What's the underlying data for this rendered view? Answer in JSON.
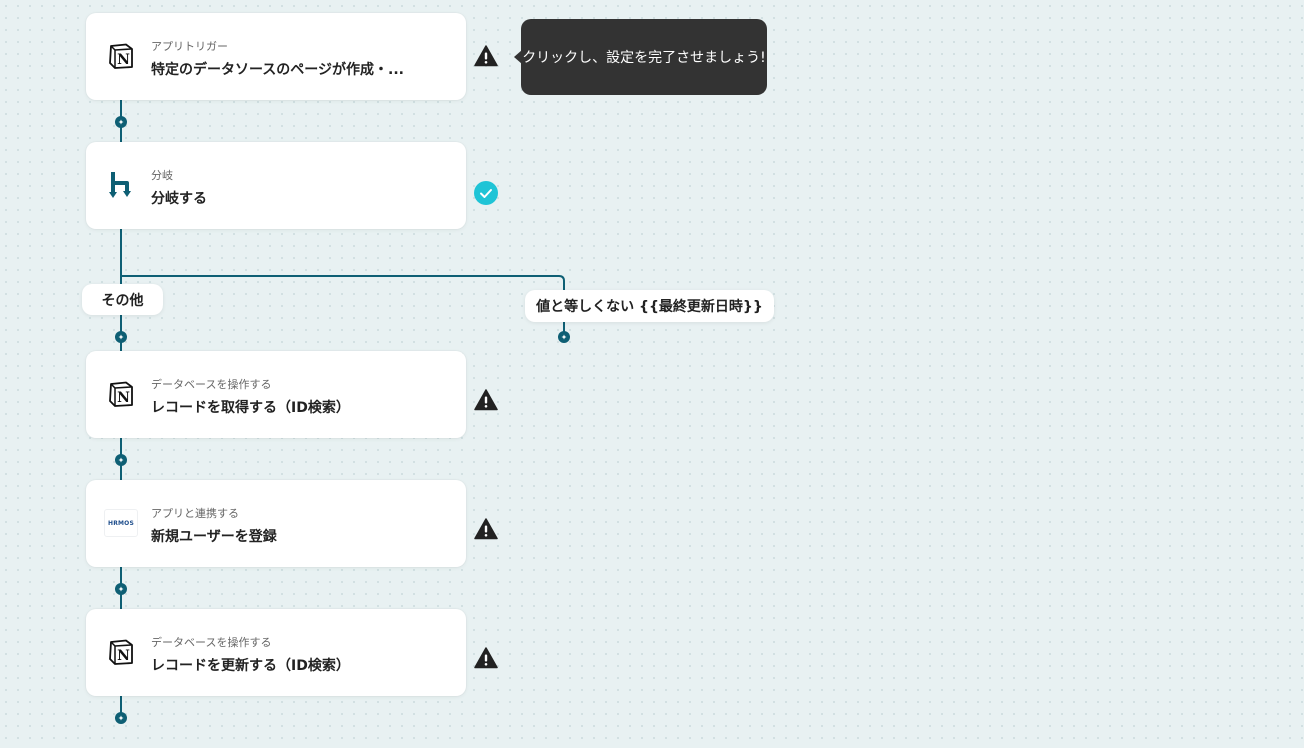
{
  "colors": {
    "accent": "#0e5f74",
    "check": "#1fc4d6",
    "warning": "#222222",
    "tooltip_bg": "#333333",
    "canvas_bg": "#e8f1f2"
  },
  "tooltip": {
    "text": "クリックし、設定を完了させましょう!"
  },
  "steps": [
    {
      "subtitle": "アプリトリガー",
      "title": "特定のデータソースのページが作成・...",
      "icon": "notion-icon",
      "status": "warning"
    },
    {
      "subtitle": "分岐",
      "title": "分岐する",
      "icon": "branch-icon",
      "status": "complete"
    },
    {
      "subtitle": "データベースを操作する",
      "title": "レコードを取得する（ID検索）",
      "icon": "notion-icon",
      "status": "warning"
    },
    {
      "subtitle": "アプリと連携する",
      "title": "新規ユーザーを登録",
      "icon": "hrmos-logo",
      "logo_text": "HRMOS",
      "status": "warning"
    },
    {
      "subtitle": "データベースを操作する",
      "title": "レコードを更新する（ID検索）",
      "icon": "notion-icon",
      "status": "warning"
    }
  ],
  "branches": {
    "other": "その他",
    "condition": "値と等しくない {{最終更新日時}}"
  }
}
